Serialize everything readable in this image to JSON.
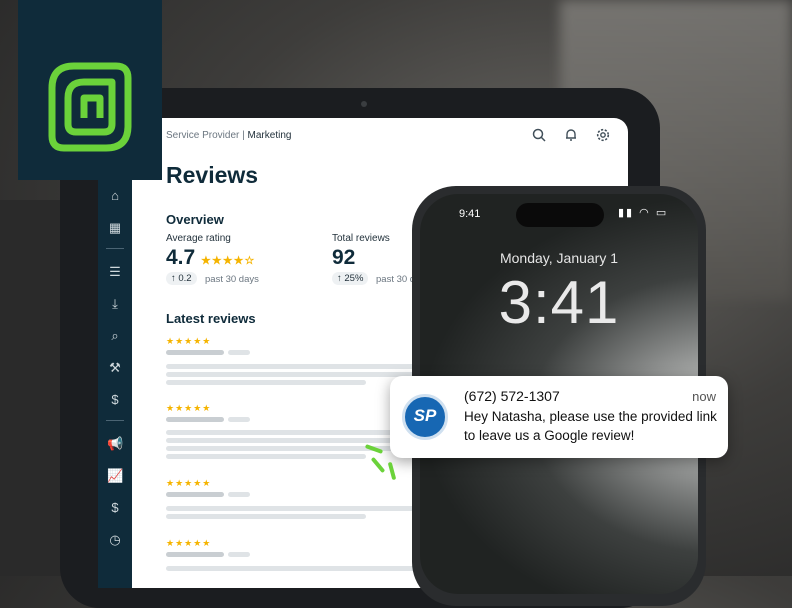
{
  "colors": {
    "brand_navy": "#0f2b3a",
    "brand_green": "#6bd23a",
    "star": "#f5b400"
  },
  "logo": {
    "icon": "brand-logo-icon"
  },
  "tablet": {
    "breadcrumb": {
      "section": "Service Provider",
      "separator": "|",
      "page": "Marketing"
    },
    "top_icons": [
      "search-icon",
      "bell-icon",
      "gear-icon"
    ],
    "sidebar_icons": [
      "home-icon",
      "calendar-icon",
      "list-icon",
      "download-icon",
      "search-zoom-icon",
      "hammer-icon",
      "dollar-doc-icon",
      "megaphone-icon",
      "chart-icon",
      "invoice-icon",
      "clock-icon"
    ],
    "title": "Reviews",
    "overview": {
      "heading": "Overview",
      "stats": [
        {
          "label": "Average rating",
          "value": "4.7",
          "stars": "★★★★☆",
          "change": "↑ 0.2",
          "note": "past 30 days"
        },
        {
          "label": "Total reviews",
          "value": "92",
          "change": "↑ 25%",
          "note": "past 30 d"
        }
      ]
    },
    "latest_heading": "Latest reviews",
    "review_stars": "★★★★★"
  },
  "phone": {
    "status_time": "9:41",
    "status_icons": "▮▮ ◠ ▭",
    "lock_date": "Monday, January 1",
    "lock_time": "3:41"
  },
  "notification": {
    "avatar_text": "SP",
    "from": "(672) 572-1307",
    "time": "now",
    "message": "Hey Natasha, please use the provided link to leave us a Google review!"
  }
}
